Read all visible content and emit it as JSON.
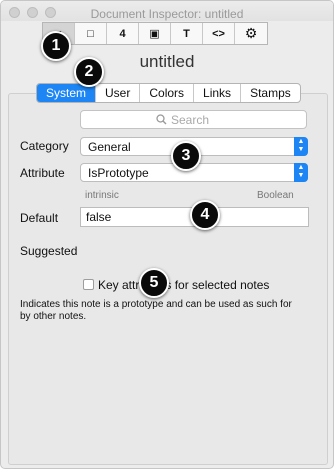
{
  "window": {
    "title": "Document Inspector: untitled"
  },
  "toolbar": {
    "buttons": [
      {
        "icon": "note-icon",
        "glyph": "■"
      },
      {
        "icon": "page-icon",
        "glyph": "□"
      },
      {
        "icon": "count-icon",
        "glyph": "4"
      },
      {
        "icon": "stack-icon",
        "glyph": "▣"
      },
      {
        "icon": "text-icon",
        "glyph": "T"
      },
      {
        "icon": "code-icon",
        "glyph": "<>"
      },
      {
        "icon": "gear-icon",
        "glyph": "⚙"
      }
    ]
  },
  "note_title": "untitled",
  "tabs": [
    "System",
    "User",
    "Colors",
    "Links",
    "Stamps"
  ],
  "active_tab": "System",
  "search": {
    "placeholder": "Search",
    "icon": "search-icon"
  },
  "category": {
    "label": "Category",
    "value": "General"
  },
  "attribute": {
    "label": "Attribute",
    "value": "IsPrototype"
  },
  "attribute_meta": {
    "scope": "intrinsic",
    "type": "Boolean"
  },
  "default": {
    "label": "Default",
    "value": "false"
  },
  "suggested": {
    "label": "Suggested"
  },
  "key_attr": {
    "label": "Key attributes for selected notes",
    "checked": false
  },
  "description": "Indicates this note is a prototype and can be used as such for by other notes.",
  "callouts": [
    "1",
    "2",
    "3",
    "4",
    "5"
  ],
  "colors": {
    "accent": "#1d86f4",
    "callout": "#0a0a0a"
  }
}
